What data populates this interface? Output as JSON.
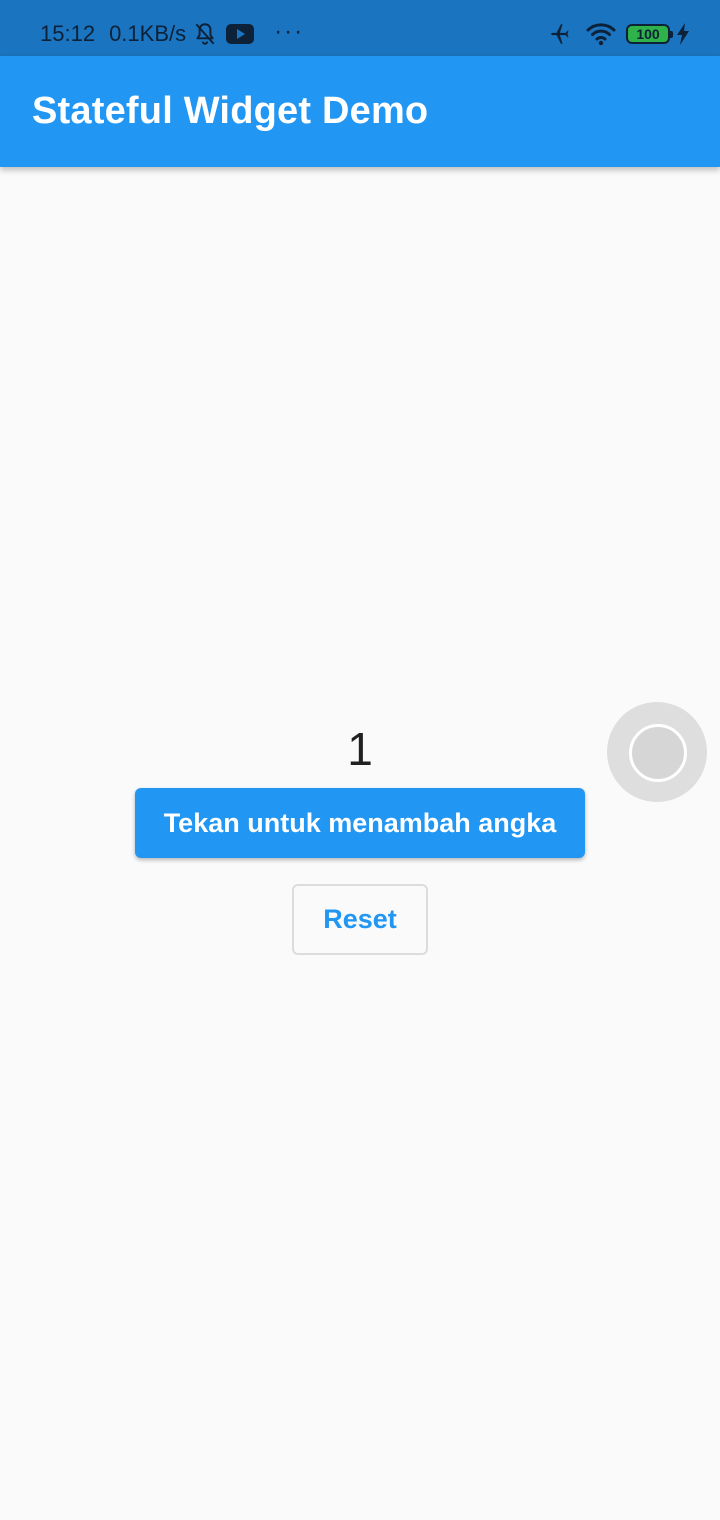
{
  "status_bar": {
    "time": "15:12",
    "network_speed": "0.1KB/s",
    "icons": [
      "bell-off-icon",
      "youtube-icon",
      "more-dots-icon",
      "airplane-icon",
      "wifi-icon",
      "battery-icon",
      "charging-icon"
    ],
    "more": "···",
    "battery_level": "100"
  },
  "app_bar": {
    "title": "Stateful Widget Demo",
    "color": "#2196f3"
  },
  "main": {
    "counter_value": "1",
    "increment_button_label": "Tekan untuk menambah angka",
    "reset_button_label": "Reset"
  },
  "colors": {
    "accent": "#2196f3",
    "status_bar": "#1b74bf",
    "background": "#fafafa",
    "battery_fill": "#2fb24a"
  }
}
